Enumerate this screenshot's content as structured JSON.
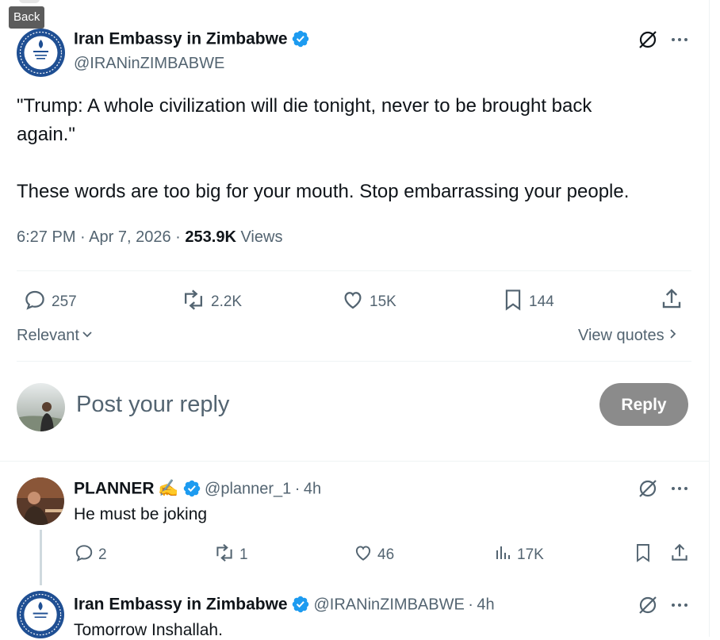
{
  "tooltip": {
    "back": "Back"
  },
  "main_tweet": {
    "author_name": "Iran Embassy in Zimbabwe",
    "handle": "@IRANinZIMBABWE",
    "text_line1": "\"Trump: A whole civilization will die tonight, never to be brought back",
    "text_line2": "again.\"",
    "text_line3": "These words are too big for your mouth. Stop embarrassing your people.",
    "time": "6:27 PM",
    "date": "Apr 7, 2026",
    "views_count": "253.9K",
    "views_label": "Views",
    "sep": "·",
    "stats": {
      "replies": "257",
      "reposts": "2.2K",
      "likes": "15K",
      "bookmarks": "144"
    }
  },
  "sort": {
    "label": "Relevant",
    "view_quotes": "View quotes"
  },
  "composer": {
    "placeholder": "Post your reply",
    "reply_button": "Reply"
  },
  "replies": [
    {
      "author_name": "PLANNER",
      "emoji": "✍️",
      "handle": "@planner_1",
      "time": "4h",
      "text": "He must be joking",
      "stats": {
        "replies": "2",
        "reposts": "1",
        "likes": "46",
        "views": "17K"
      }
    },
    {
      "author_name": "Iran Embassy in Zimbabwe",
      "handle": "@IRANinZIMBABWE",
      "time": "4h",
      "text": "Tomorrow Inshallah."
    }
  ],
  "colors": {
    "verified": "#1d9bf0",
    "text": "#0f1419",
    "muted": "#536471",
    "reply_button": "#8b8b8b"
  }
}
